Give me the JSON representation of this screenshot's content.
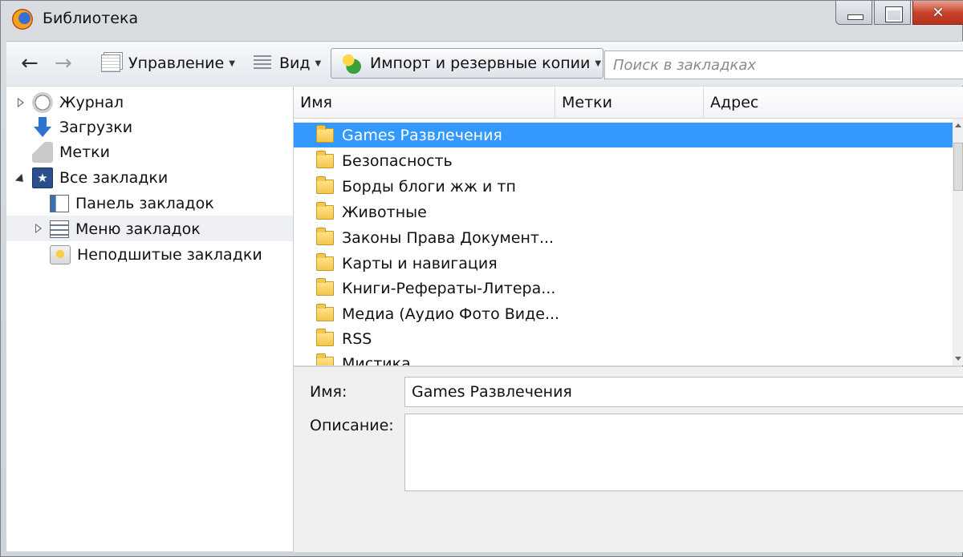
{
  "window": {
    "title": "Библиотека"
  },
  "toolbar": {
    "back_label": "←",
    "forward_label": "→",
    "manage_label": "Управление",
    "view_label": "Вид",
    "import_label": "Импорт и резервные копии",
    "search_placeholder": "Поиск в закладках"
  },
  "sidebar": {
    "items": [
      {
        "label": "Журнал",
        "icon": "clock-icon"
      },
      {
        "label": "Загрузки",
        "icon": "download-arrow-icon"
      },
      {
        "label": "Метки",
        "icon": "tag-icon"
      },
      {
        "label": "Все закладки",
        "icon": "star-bookmarks-icon"
      },
      {
        "label": "Панель закладок",
        "icon": "bookmarks-toolbar-icon"
      },
      {
        "label": "Меню закладок",
        "icon": "bookmarks-menu-icon"
      },
      {
        "label": "Неподшитые закладки",
        "icon": "unsorted-bookmarks-icon"
      }
    ]
  },
  "list": {
    "columns": [
      "Имя",
      "Метки",
      "Адрес"
    ],
    "rows": [
      "Games Развлечения",
      "Безопасность",
      "Борды блоги жж и тп",
      "Животные",
      "Законы Права Документ...",
      "Карты и навигация",
      "Книги-Рефераты-Литера...",
      "Медиа (Аудио Фото Виде...",
      "RSS",
      "Мистика"
    ]
  },
  "details": {
    "name_label": "Имя:",
    "name_value": "Games Развлечения",
    "description_label": "Описание:",
    "description_value": ""
  },
  "colors": {
    "selection": "#3399ff",
    "close_button": "#c8432b"
  }
}
